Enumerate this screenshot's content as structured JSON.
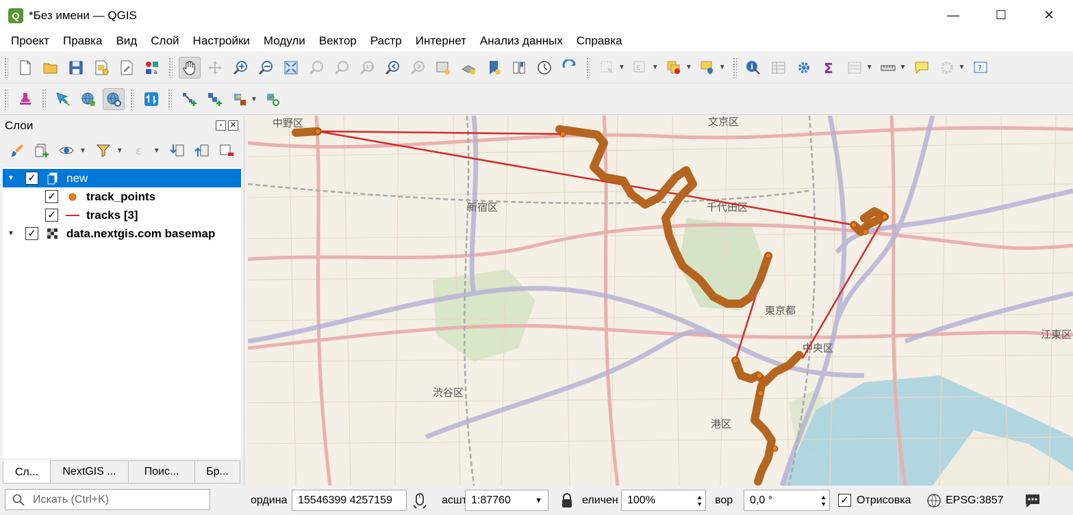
{
  "window": {
    "title": "*Без имени — QGIS",
    "app_icon_letter": "Q",
    "minimize": "—",
    "maximize": "☐",
    "close": "✕"
  },
  "menu": [
    "Проект",
    "Правка",
    "Вид",
    "Слой",
    "Настройки",
    "Модули",
    "Вектор",
    "Растр",
    "Интернет",
    "Анализ данных",
    "Справка"
  ],
  "layers_panel": {
    "title": "Слои",
    "layers": [
      {
        "name": "new",
        "checked": true,
        "expanded": true,
        "selected": true
      },
      {
        "name": "track_points",
        "checked": true,
        "bold": true
      },
      {
        "name": "tracks [3]",
        "checked": true,
        "bold": true
      },
      {
        "name": "data.nextgis.com basemap",
        "checked": true,
        "bold": true
      }
    ],
    "tabs": [
      "Сл...",
      "NextGIS ...",
      "Поис...",
      "Бр..."
    ]
  },
  "map": {
    "labels": [
      "中野区",
      "文京区",
      "千代田区",
      "新宿区",
      "東京都",
      "中央区",
      "渋谷区",
      "港区",
      "江東区"
    ],
    "colors": {
      "track_points": "#b5651d",
      "tracks": "#d42a2a",
      "highlight": "#f07c1a"
    }
  },
  "status": {
    "search_placeholder": "Искать (Ctrl+K)",
    "coord_label": "ордина",
    "coord_value": "15546399  4257159",
    "scale_label": "Масштаб",
    "scale_label_visible": "асшт",
    "scale_value": "1:87760",
    "magnifier_label": "еличен",
    "magnifier_value": "100%",
    "rotation_label": "ворот",
    "rotation_label_visible": "вор",
    "rotation_value": "0,0 °",
    "render_label": "Отрисовка",
    "render_checked": true,
    "crs": "EPSG:3857"
  }
}
